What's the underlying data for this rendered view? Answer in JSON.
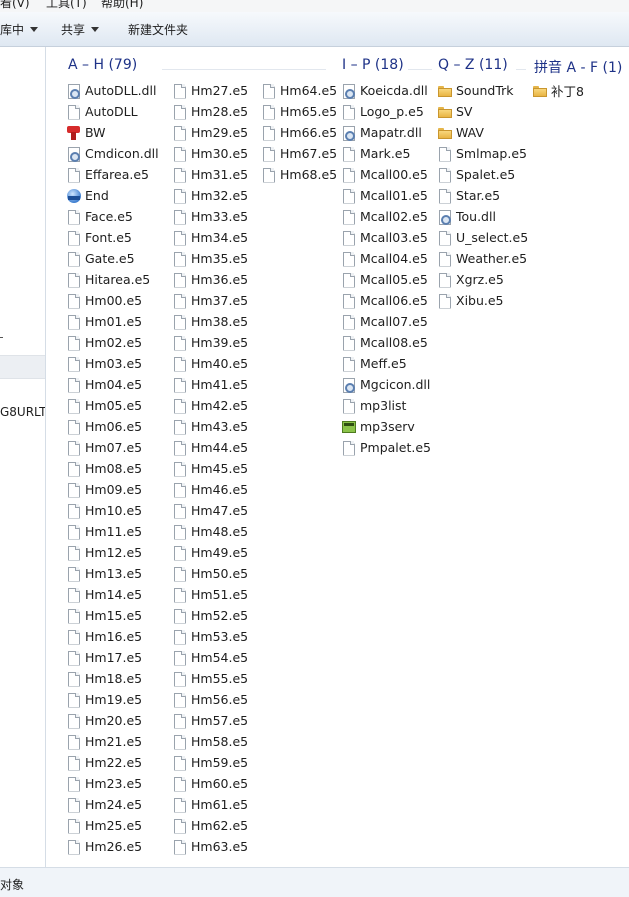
{
  "menubar": {
    "view": "看(V)",
    "tools": "工具(T)",
    "help": "帮助(H)"
  },
  "toolbar": {
    "include_library": "库中",
    "share": "共享",
    "new_folder": "新建文件夹"
  },
  "navpane": {
    "partial_text": "G8URLT"
  },
  "statusbar": {
    "text": "对象"
  },
  "groups": [
    {
      "key": "ah",
      "title": "A – H (79)",
      "columns": [
        [
          {
            "name": "AutoDLL.dll",
            "icon": "dll"
          },
          {
            "name": "AutoDLL",
            "icon": "file"
          },
          {
            "name": "BW",
            "icon": "exe-red"
          },
          {
            "name": "Cmdicon.dll",
            "icon": "dll"
          },
          {
            "name": "Effarea.e5",
            "icon": "file"
          },
          {
            "name": "End",
            "icon": "app-blue"
          },
          {
            "name": "Face.e5",
            "icon": "file"
          },
          {
            "name": "Font.e5",
            "icon": "file"
          },
          {
            "name": "Gate.e5",
            "icon": "file"
          },
          {
            "name": "Hitarea.e5",
            "icon": "file"
          },
          {
            "name": "Hm00.e5",
            "icon": "file"
          },
          {
            "name": "Hm01.e5",
            "icon": "file"
          },
          {
            "name": "Hm02.e5",
            "icon": "file"
          },
          {
            "name": "Hm03.e5",
            "icon": "file"
          },
          {
            "name": "Hm04.e5",
            "icon": "file"
          },
          {
            "name": "Hm05.e5",
            "icon": "file"
          },
          {
            "name": "Hm06.e5",
            "icon": "file"
          },
          {
            "name": "Hm07.e5",
            "icon": "file"
          },
          {
            "name": "Hm08.e5",
            "icon": "file"
          },
          {
            "name": "Hm09.e5",
            "icon": "file"
          },
          {
            "name": "Hm10.e5",
            "icon": "file"
          },
          {
            "name": "Hm11.e5",
            "icon": "file"
          },
          {
            "name": "Hm12.e5",
            "icon": "file"
          },
          {
            "name": "Hm13.e5",
            "icon": "file"
          },
          {
            "name": "Hm14.e5",
            "icon": "file"
          },
          {
            "name": "Hm15.e5",
            "icon": "file"
          },
          {
            "name": "Hm16.e5",
            "icon": "file"
          },
          {
            "name": "Hm17.e5",
            "icon": "file"
          },
          {
            "name": "Hm18.e5",
            "icon": "file"
          },
          {
            "name": "Hm19.e5",
            "icon": "file"
          },
          {
            "name": "Hm20.e5",
            "icon": "file"
          },
          {
            "name": "Hm21.e5",
            "icon": "file"
          },
          {
            "name": "Hm22.e5",
            "icon": "file"
          },
          {
            "name": "Hm23.e5",
            "icon": "file"
          },
          {
            "name": "Hm24.e5",
            "icon": "file"
          },
          {
            "name": "Hm25.e5",
            "icon": "file"
          },
          {
            "name": "Hm26.e5",
            "icon": "file"
          }
        ],
        [
          {
            "name": "Hm27.e5",
            "icon": "file"
          },
          {
            "name": "Hm28.e5",
            "icon": "file"
          },
          {
            "name": "Hm29.e5",
            "icon": "file"
          },
          {
            "name": "Hm30.e5",
            "icon": "file"
          },
          {
            "name": "Hm31.e5",
            "icon": "file"
          },
          {
            "name": "Hm32.e5",
            "icon": "file"
          },
          {
            "name": "Hm33.e5",
            "icon": "file"
          },
          {
            "name": "Hm34.e5",
            "icon": "file"
          },
          {
            "name": "Hm35.e5",
            "icon": "file"
          },
          {
            "name": "Hm36.e5",
            "icon": "file"
          },
          {
            "name": "Hm37.e5",
            "icon": "file"
          },
          {
            "name": "Hm38.e5",
            "icon": "file"
          },
          {
            "name": "Hm39.e5",
            "icon": "file"
          },
          {
            "name": "Hm40.e5",
            "icon": "file"
          },
          {
            "name": "Hm41.e5",
            "icon": "file"
          },
          {
            "name": "Hm42.e5",
            "icon": "file"
          },
          {
            "name": "Hm43.e5",
            "icon": "file"
          },
          {
            "name": "Hm44.e5",
            "icon": "file"
          },
          {
            "name": "Hm45.e5",
            "icon": "file"
          },
          {
            "name": "Hm46.e5",
            "icon": "file"
          },
          {
            "name": "Hm47.e5",
            "icon": "file"
          },
          {
            "name": "Hm48.e5",
            "icon": "file"
          },
          {
            "name": "Hm49.e5",
            "icon": "file"
          },
          {
            "name": "Hm50.e5",
            "icon": "file"
          },
          {
            "name": "Hm51.e5",
            "icon": "file"
          },
          {
            "name": "Hm52.e5",
            "icon": "file"
          },
          {
            "name": "Hm53.e5",
            "icon": "file"
          },
          {
            "name": "Hm54.e5",
            "icon": "file"
          },
          {
            "name": "Hm55.e5",
            "icon": "file"
          },
          {
            "name": "Hm56.e5",
            "icon": "file"
          },
          {
            "name": "Hm57.e5",
            "icon": "file"
          },
          {
            "name": "Hm58.e5",
            "icon": "file"
          },
          {
            "name": "Hm59.e5",
            "icon": "file"
          },
          {
            "name": "Hm60.e5",
            "icon": "file"
          },
          {
            "name": "Hm61.e5",
            "icon": "file"
          },
          {
            "name": "Hm62.e5",
            "icon": "file"
          },
          {
            "name": "Hm63.e5",
            "icon": "file"
          }
        ],
        [
          {
            "name": "Hm64.e5",
            "icon": "file"
          },
          {
            "name": "Hm65.e5",
            "icon": "file"
          },
          {
            "name": "Hm66.e5",
            "icon": "file"
          },
          {
            "name": "Hm67.e5",
            "icon": "file"
          },
          {
            "name": "Hm68.e5",
            "icon": "file"
          }
        ]
      ]
    },
    {
      "key": "ip",
      "title": "I – P (18)",
      "columns": [
        [
          {
            "name": "Koeicda.dll",
            "icon": "dll"
          },
          {
            "name": "Logo_p.e5",
            "icon": "file"
          },
          {
            "name": "Mapatr.dll",
            "icon": "dll"
          },
          {
            "name": "Mark.e5",
            "icon": "file"
          },
          {
            "name": "Mcall00.e5",
            "icon": "file"
          },
          {
            "name": "Mcall01.e5",
            "icon": "file"
          },
          {
            "name": "Mcall02.e5",
            "icon": "file"
          },
          {
            "name": "Mcall03.e5",
            "icon": "file"
          },
          {
            "name": "Mcall04.e5",
            "icon": "file"
          },
          {
            "name": "Mcall05.e5",
            "icon": "file"
          },
          {
            "name": "Mcall06.e5",
            "icon": "file"
          },
          {
            "name": "Mcall07.e5",
            "icon": "file"
          },
          {
            "name": "Mcall08.e5",
            "icon": "file"
          },
          {
            "name": "Meff.e5",
            "icon": "file"
          },
          {
            "name": "Mgcicon.dll",
            "icon": "dll"
          },
          {
            "name": "mp3list",
            "icon": "file"
          },
          {
            "name": "mp3serv",
            "icon": "exe-green"
          },
          {
            "name": "Pmpalet.e5",
            "icon": "file"
          }
        ]
      ]
    },
    {
      "key": "qz",
      "title": "Q – Z (11)",
      "columns": [
        [
          {
            "name": "SoundTrk",
            "icon": "folder"
          },
          {
            "name": "SV",
            "icon": "folder"
          },
          {
            "name": "WAV",
            "icon": "folder"
          },
          {
            "name": "Smlmap.e5",
            "icon": "file"
          },
          {
            "name": "Spalet.e5",
            "icon": "file"
          },
          {
            "name": "Star.e5",
            "icon": "file"
          },
          {
            "name": "Tou.dll",
            "icon": "dll"
          },
          {
            "name": "U_select.e5",
            "icon": "file"
          },
          {
            "name": "Weather.e5",
            "icon": "file"
          },
          {
            "name": "Xgrz.e5",
            "icon": "file"
          },
          {
            "name": "Xibu.e5",
            "icon": "file"
          }
        ]
      ]
    },
    {
      "key": "pinyin",
      "title": "拼音 A - F (1)",
      "columns": [
        [
          {
            "name": "补丁8",
            "icon": "folder"
          }
        ]
      ]
    }
  ]
}
